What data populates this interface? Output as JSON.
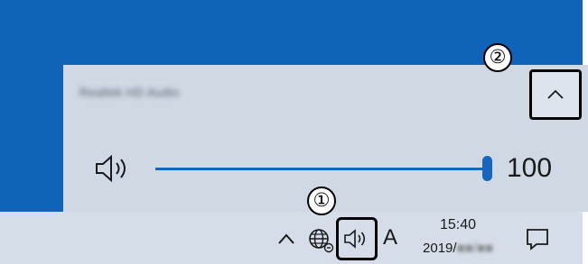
{
  "flyout": {
    "device_name": "Realtek HD Audio",
    "volume_value": "100",
    "volume_level_percent": 100
  },
  "callouts": {
    "one": "①",
    "two": "②"
  },
  "taskbar": {
    "ime_label": "A",
    "time": "15:40",
    "date_prefix": "2019/",
    "date_blurred": "■■/■■"
  },
  "colors": {
    "desktop": "#0f63b8",
    "flyout_bg": "#cfd9e4",
    "accent": "#1666be",
    "taskbar_bg": "#d4dde8"
  }
}
